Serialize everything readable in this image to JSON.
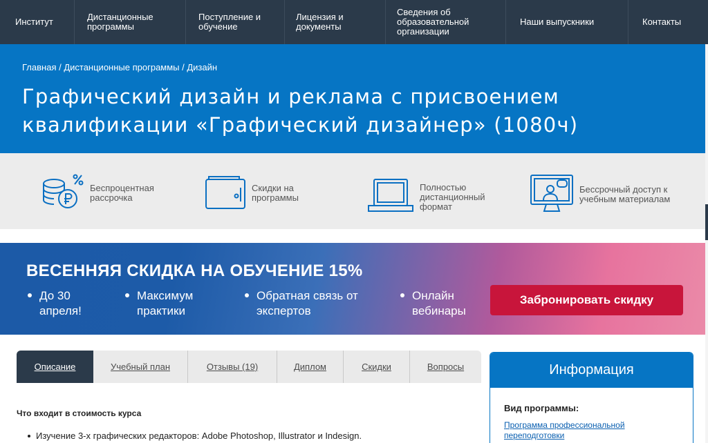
{
  "nav": {
    "items": [
      {
        "label": "Институт"
      },
      {
        "label": "Дистанционные программы"
      },
      {
        "label": "Поступление и обучение"
      },
      {
        "label": "Лицензия и документы"
      },
      {
        "label": "Сведения об образовательной организации"
      },
      {
        "label": "Наши выпускники"
      },
      {
        "label": "Контакты"
      }
    ]
  },
  "breadcrumb": {
    "home": "Главная",
    "programs": "Дистанционные программы",
    "current": "Дизайн",
    "sep": " / "
  },
  "hero": {
    "title": "Графический дизайн и реклама с присвоением квалификации «Графический дизайнер» (1080ч)"
  },
  "features": [
    {
      "icon": "coins-percent-icon",
      "text": "Беспроцентная рассрочка"
    },
    {
      "icon": "wallet-icon",
      "text": "Скидки на программы"
    },
    {
      "icon": "laptop-icon",
      "text": "Полностью дистанционный формат"
    },
    {
      "icon": "monitor-person-icon",
      "text": "Бессрочный доступ к учебным материалам"
    }
  ],
  "promo": {
    "title": "ВЕСЕННЯЯ СКИДКА НА ОБУЧЕНИЕ  15%",
    "points": [
      {
        "line1": "До 30",
        "line2": "апреля!"
      },
      {
        "line1": "Максимум",
        "line2": "практики"
      },
      {
        "line1": "Обратная связь от",
        "line2": "экспертов"
      },
      {
        "line1": "Онлайн",
        "line2": "вебинары"
      }
    ],
    "button": "Забронировать скидку"
  },
  "tabs": [
    {
      "label": "Описание",
      "active": true
    },
    {
      "label": "Учебный план"
    },
    {
      "label": "Отзывы (19)"
    },
    {
      "label": "Диплом"
    },
    {
      "label": "Скидки"
    },
    {
      "label": "Вопросы"
    }
  ],
  "content": {
    "heading": "Что входит в стоимость курса",
    "items": [
      "Изучение 3-х графических редакторов: Adobe Photoshop, Illustrator и Indesign."
    ]
  },
  "info": {
    "title": "Информация",
    "label": "Вид программы:",
    "link": "Программа профессиональной переподготовки"
  },
  "colors": {
    "nav_bg": "#2b3a4a",
    "brand_blue": "#0675c4",
    "cta_red": "#c8153b"
  }
}
